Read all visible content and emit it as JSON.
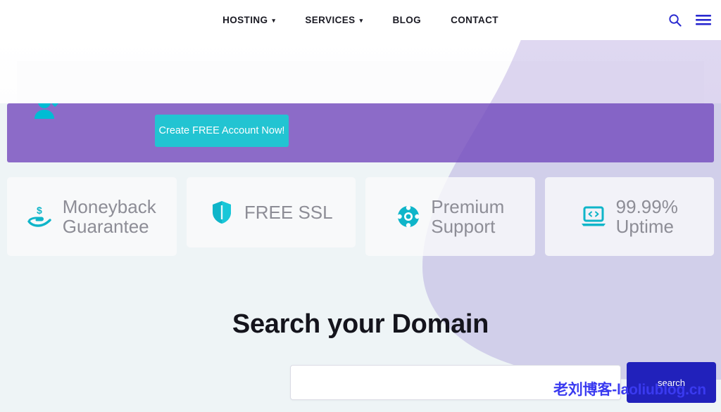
{
  "nav": {
    "items": [
      {
        "label": "HOSTING",
        "has_caret": true,
        "icon": "chevron-down-icon"
      },
      {
        "label": "SERVICES",
        "has_caret": true,
        "icon": "chevron-down-icon"
      },
      {
        "label": "BLOG",
        "has_caret": false
      },
      {
        "label": "CONTACT",
        "has_caret": false
      }
    ],
    "search_icon": "search-icon",
    "menu_icon": "hamburger-menu-icon",
    "icon_color": "#2a2ad0"
  },
  "banner": {
    "person_icon": "user-check-icon",
    "cta_label": "Create FREE Account Now!",
    "background_color": "#8c6bc8",
    "cta_color": "#22c4d2"
  },
  "features": [
    {
      "label": "Moneyback\nGuarantee",
      "icon": "hand-money-icon",
      "size": "tall"
    },
    {
      "label": "FREE SSL",
      "icon": "shield-icon",
      "size": "short"
    },
    {
      "label": "Premium\nSupport",
      "icon": "lifebuoy-icon",
      "size": "tall"
    },
    {
      "label": "99.99%\nUptime",
      "icon": "laptop-code-icon",
      "size": "tall"
    }
  ],
  "search": {
    "heading": "Search your Domain",
    "input_value": "",
    "input_placeholder": "",
    "button_label": "search",
    "button_color": "#2121bb"
  },
  "watermark": {
    "text": "老刘博客-laoliublog.cn",
    "color": "#3a3af0"
  },
  "theme": {
    "page_background": "#eef4f6",
    "accent_cyan": "#22c4d2",
    "accent_purple": "#8c6bc8",
    "text_dark": "#14141c",
    "text_muted": "#8d8d96"
  }
}
